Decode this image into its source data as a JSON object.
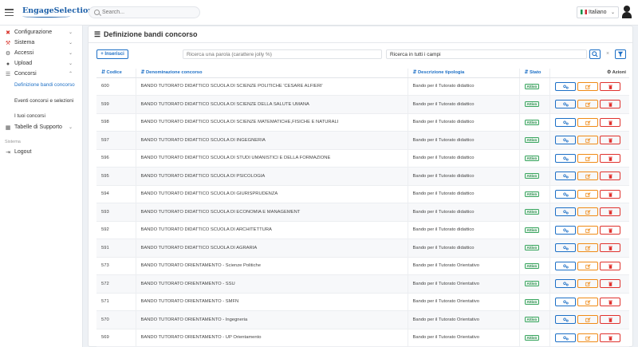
{
  "header": {
    "logo_text": "EngageSelection",
    "search_placeholder": "Search...",
    "language": "Italiano"
  },
  "sidebar": {
    "items": [
      {
        "label": "Configurazione",
        "icon": "tools-icon"
      },
      {
        "label": "Sistema",
        "icon": "wrench-icon"
      },
      {
        "label": "Accessi",
        "icon": "settings-icon"
      },
      {
        "label": "Upload",
        "icon": "user-icon"
      },
      {
        "label": "Concorsi",
        "icon": "list-icon"
      }
    ],
    "sub_items": [
      "Definizione bandi concorso",
      "Eventi concorsi e selezioni",
      "I tuoi concorsi"
    ],
    "tabelle": "Tabelle di Supporto",
    "section_label": "Sistema",
    "logout": "Logout"
  },
  "main": {
    "title": "Definizione bandi concorso",
    "insert_label": "+ Inserisci",
    "filter_placeholder": "Ricerca una parola (carattere jolly %)",
    "filter_scope": "Ricerca in tutti i campi",
    "clear_symbol": "×",
    "columns": {
      "code": "Codice",
      "name": "Denominazione concorso",
      "type": "Descrizione tipologia",
      "state": "Stato",
      "actions": "Azioni"
    },
    "rows": [
      {
        "code": "600",
        "name": "BANDO TUTORATO DIDATTICO SCUOLA DI SCIENZE POLITICHE 'CESARE ALFIERI'",
        "type": "Bando per il Tutorato didattico",
        "state": "Attivo"
      },
      {
        "code": "599",
        "name": "BANDO TUTORATO DIDATTICO SCUOLA DI SCIENZE DELLA SALUTE UMANA",
        "type": "Bando per il Tutorato didattico",
        "state": "Attivo"
      },
      {
        "code": "598",
        "name": "BANDO TUTORATO DIDATTICO SCUOLA DI SCIENZE MATEMATICHE,FISICHE E NATURALI",
        "type": "Bando per il Tutorato didattico",
        "state": "Attivo"
      },
      {
        "code": "597",
        "name": "BANDO TUTORATO DIDATTICO SCUOLA DI INGEGNERIA",
        "type": "Bando per il Tutorato didattico",
        "state": "Attivo"
      },
      {
        "code": "596",
        "name": "BANDO TUTORATO DIDATTICO SCUOLA DI STUDI UMANISTICI E DELLA FORMAZIONE",
        "type": "Bando per il Tutorato didattico",
        "state": "Attivo"
      },
      {
        "code": "595",
        "name": "BANDO TUTORATO DIDATTICO SCUOLA DI PSICOLOGIA",
        "type": "Bando per il Tutorato didattico",
        "state": "Attivo"
      },
      {
        "code": "594",
        "name": "BANDO TUTORATO DIDATTICO SCUOLA DI GIURISPRUDENZA",
        "type": "Bando per il Tutorato didattico",
        "state": "Attivo"
      },
      {
        "code": "593",
        "name": "BANDO TUTORATO DIDATTICO SCUOLA DI ECONOMIA E MANAGEMENT",
        "type": "Bando per il Tutorato didattico",
        "state": "Attivo"
      },
      {
        "code": "592",
        "name": "BANDO TUTORATO DIDATTICO SCUOLA DI ARCHITETTURA",
        "type": "Bando per il Tutorato didattico",
        "state": "Attivo"
      },
      {
        "code": "591",
        "name": "BANDO TUTORATO DIDATTICO SCUOLA DI AGRARIA",
        "type": "Bando per il Tutorato didattico",
        "state": "Attivo"
      },
      {
        "code": "573",
        "name": "BANDO TUTORATO ORIENTAMENTO - Scienze Politiche",
        "type": "Bando per il Tutorato Orientativo",
        "state": "Attivo"
      },
      {
        "code": "572",
        "name": "BANDO TUTORATO ORIENTAMENTO - SSU",
        "type": "Bando per il Tutorato Orientativo",
        "state": "Attivo"
      },
      {
        "code": "571",
        "name": "BANDO TUTORATO ORIENTAMENTO - SMFN",
        "type": "Bando per il Tutorato Orientativo",
        "state": "Attivo"
      },
      {
        "code": "570",
        "name": "BANDO TUTORATO ORIENTAMENTO - Ingegneria",
        "type": "Bando per il Tutorato Orientativo",
        "state": "Attivo"
      },
      {
        "code": "569",
        "name": "BANDO TUTORATO ORIENTAMENTO - UP Orientamento",
        "type": "Bando per il Tutorato Orientativo",
        "state": "Attivo"
      }
    ]
  }
}
